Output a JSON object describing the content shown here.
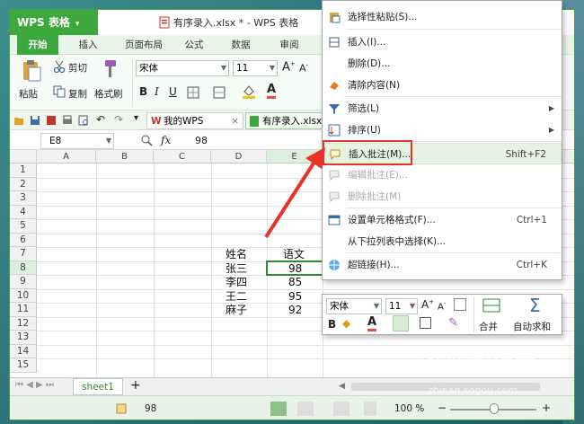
{
  "app": {
    "name": "WPS 表格",
    "doc_title": "有序录入.xlsx * - WPS 表格"
  },
  "ribbon_tabs": [
    "开始",
    "插入",
    "页面布局",
    "公式",
    "数据",
    "审阅"
  ],
  "ribbon": {
    "paste": "粘贴",
    "cut": "剪切",
    "copy": "复制",
    "format_painter": "格式刷",
    "font": "宋体",
    "font_size": "11",
    "bold": "B",
    "italic": "I",
    "underline": "U"
  },
  "doc_tabs": [
    {
      "label": "我的WPS"
    },
    {
      "label": "有序录入.xlsx *"
    }
  ],
  "formula_bar": {
    "cell_ref": "E8",
    "fx": "fx",
    "value": "98"
  },
  "columns": [
    "A",
    "B",
    "C",
    "D",
    "E"
  ],
  "rows": [
    "1",
    "2",
    "3",
    "4",
    "5",
    "6",
    "7",
    "8",
    "9",
    "10",
    "11",
    "12",
    "13",
    "14",
    "15"
  ],
  "table": {
    "header": [
      "姓名",
      "语文"
    ],
    "rows": [
      [
        "张三",
        "98"
      ],
      [
        "李四",
        "85"
      ],
      [
        "王二",
        "95"
      ],
      [
        "麻子",
        "92"
      ]
    ]
  },
  "context_menu": {
    "items": [
      {
        "label": "选择性粘贴(S)...",
        "shortcut": "",
        "submenu": false,
        "disabled": false,
        "highlight": false
      },
      {
        "label": "插入(I)...",
        "shortcut": "",
        "submenu": false,
        "disabled": false,
        "highlight": false
      },
      {
        "label": "删除(D)...",
        "shortcut": "",
        "submenu": false,
        "disabled": false,
        "highlight": false
      },
      {
        "label": "清除内容(N)",
        "shortcut": "",
        "submenu": false,
        "disabled": false,
        "highlight": false
      },
      {
        "label": "筛选(L)",
        "shortcut": "",
        "submenu": true,
        "disabled": false,
        "highlight": false
      },
      {
        "label": "排序(U)",
        "shortcut": "",
        "submenu": true,
        "disabled": false,
        "highlight": false
      },
      {
        "label": "插入批注(M)...",
        "shortcut": "Shift+F2",
        "submenu": false,
        "disabled": false,
        "highlight": true
      },
      {
        "label": "编辑批注(E)...",
        "shortcut": "",
        "submenu": false,
        "disabled": true,
        "highlight": false
      },
      {
        "label": "删除批注(M)",
        "shortcut": "",
        "submenu": false,
        "disabled": true,
        "highlight": false
      },
      {
        "label": "设置单元格格式(F)...",
        "shortcut": "Ctrl+1",
        "submenu": false,
        "disabled": false,
        "highlight": false
      },
      {
        "label": "从下拉列表中选择(K)...",
        "shortcut": "",
        "submenu": false,
        "disabled": false,
        "highlight": false
      },
      {
        "label": "超链接(H)...",
        "shortcut": "Ctrl+K",
        "submenu": false,
        "disabled": false,
        "highlight": false
      }
    ]
  },
  "mini_toolbar": {
    "font": "宋体",
    "size": "11",
    "merge": "合并",
    "autosum": "自动求和"
  },
  "sheet_tab": "sheet1",
  "status": {
    "value": "98",
    "zoom": "100 %"
  },
  "watermark": {
    "text": "搜狗指南",
    "url": "zhinan.sogou.com"
  },
  "colors": {
    "accent": "#3da83d",
    "highlight_box": "#e8322a"
  }
}
